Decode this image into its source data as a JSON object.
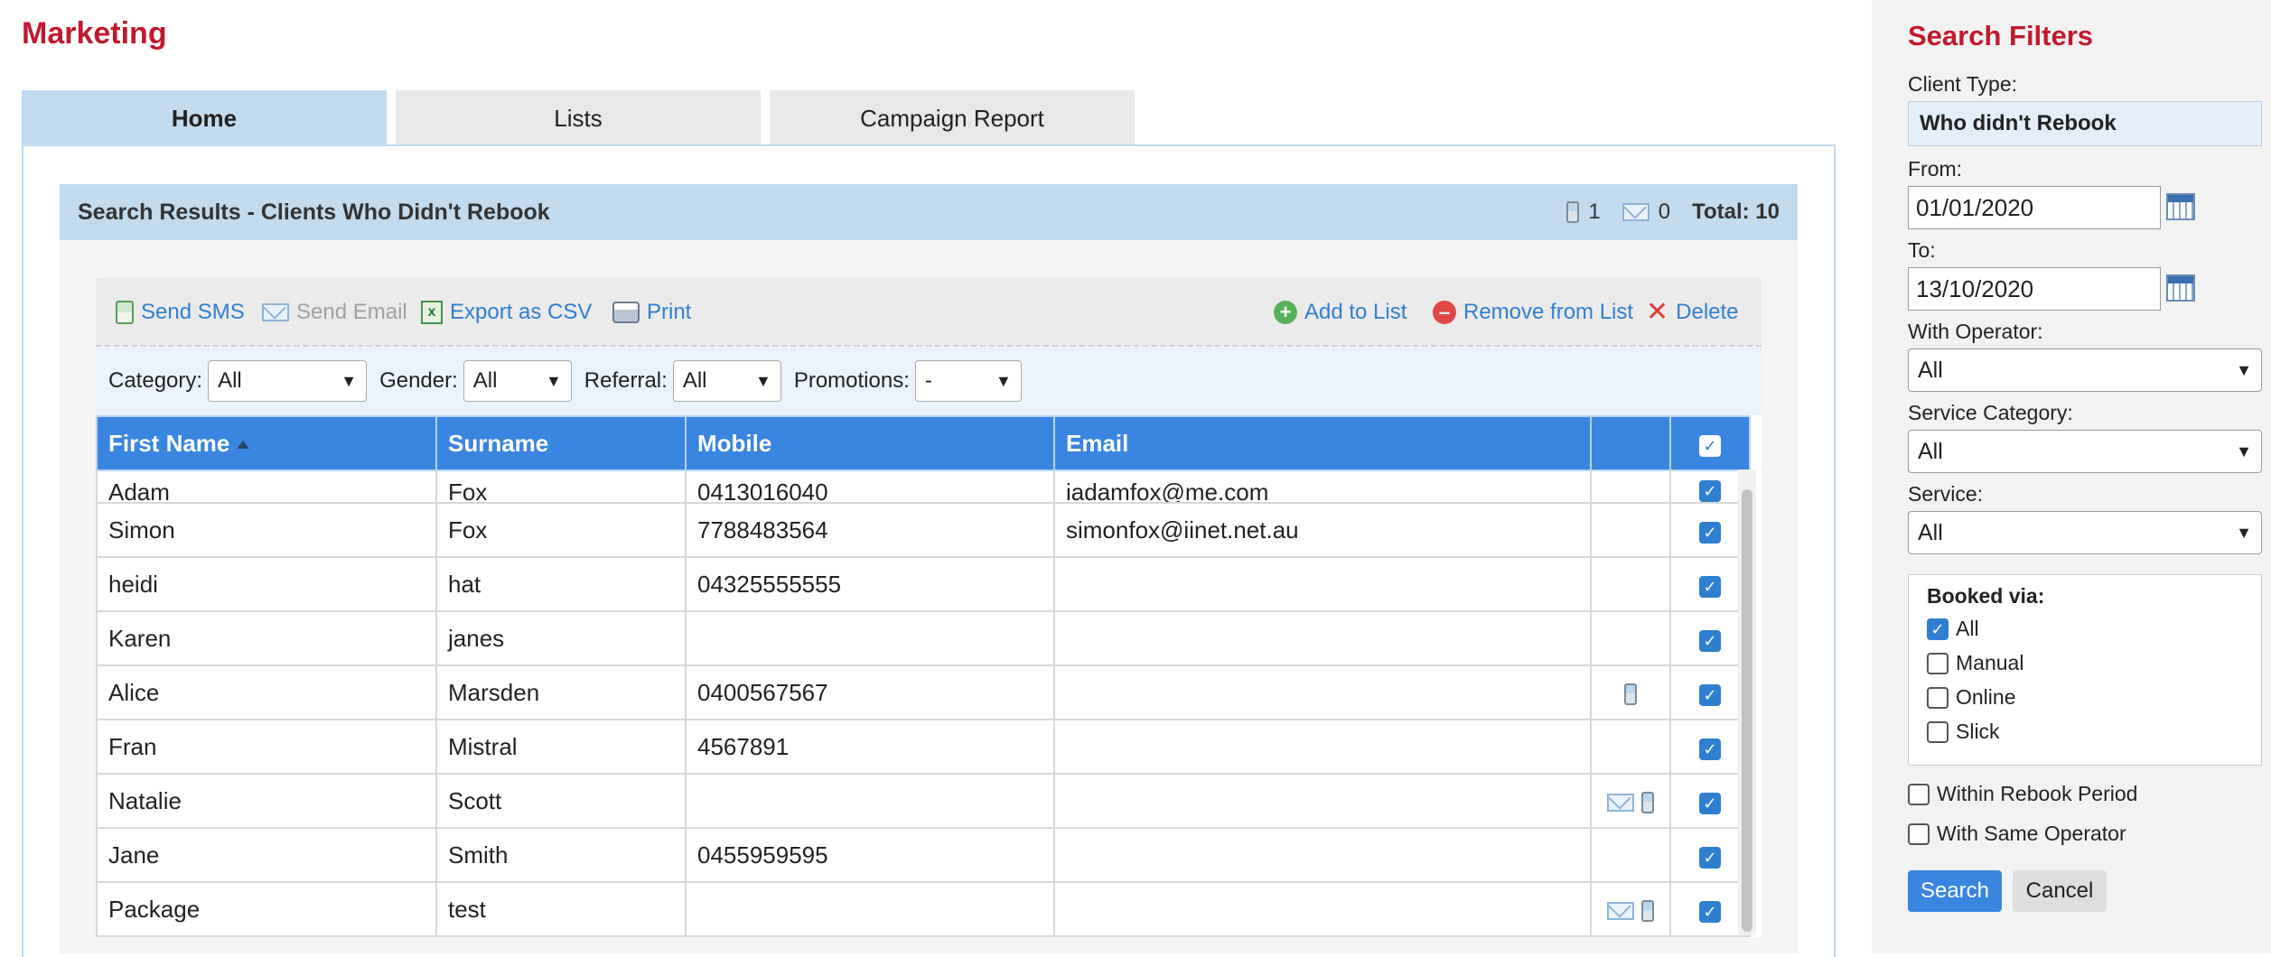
{
  "page": {
    "title": "Marketing"
  },
  "tabs": [
    {
      "label": "Home",
      "active": true
    },
    {
      "label": "Lists",
      "active": false
    },
    {
      "label": "Campaign Report",
      "active": false
    }
  ],
  "results": {
    "title": "Search Results - Clients Who Didn't Rebook",
    "sms_count": "1",
    "email_count": "0",
    "total": "Total: 10"
  },
  "toolbar": {
    "send_sms": "Send SMS",
    "send_email": "Send Email",
    "export_csv": "Export as CSV",
    "print": "Print",
    "add_to_list": "Add to List",
    "remove_from_list": "Remove from List",
    "delete": "Delete"
  },
  "filters": {
    "category_label": "Category:",
    "category_value": "All",
    "gender_label": "Gender:",
    "gender_value": "All",
    "referral_label": "Referral:",
    "referral_value": "All",
    "promotions_label": "Promotions:",
    "promotions_value": "-"
  },
  "table": {
    "columns": [
      "First Name",
      "Surname",
      "Mobile",
      "Email"
    ],
    "rows": [
      {
        "first": "Adam",
        "surname": "Fox",
        "mobile": "0413016040",
        "email": "iadamfox@me.com",
        "icons": "",
        "checked": true
      },
      {
        "first": "Simon",
        "surname": "Fox",
        "mobile": "7788483564",
        "email": "simonfox@iinet.net.au",
        "icons": "",
        "checked": true
      },
      {
        "first": "heidi",
        "surname": "hat",
        "mobile": "04325555555",
        "email": "",
        "icons": "",
        "checked": true
      },
      {
        "first": "Karen",
        "surname": "janes",
        "mobile": "",
        "email": "",
        "icons": "",
        "checked": true
      },
      {
        "first": "Alice",
        "surname": "Marsden",
        "mobile": "0400567567",
        "email": "",
        "icons": "phone",
        "checked": true
      },
      {
        "first": "Fran",
        "surname": "Mistral",
        "mobile": "4567891",
        "email": "",
        "icons": "",
        "checked": true
      },
      {
        "first": "Natalie",
        "surname": "Scott",
        "mobile": "",
        "email": "",
        "icons": "mail-phone",
        "checked": true
      },
      {
        "first": "Jane",
        "surname": "Smith",
        "mobile": "0455959595",
        "email": "",
        "icons": "",
        "checked": true
      },
      {
        "first": "Package",
        "surname": "test",
        "mobile": "",
        "email": "",
        "icons": "mail-phone",
        "checked": true
      }
    ]
  },
  "sidebar": {
    "title": "Search Filters",
    "client_type_label": "Client Type:",
    "client_type_value": "Who didn't Rebook",
    "from_label": "From:",
    "from_value": "01/01/2020",
    "to_label": "To:",
    "to_value": "13/10/2020",
    "operator_label": "With Operator:",
    "operator_value": "All",
    "service_category_label": "Service Category:",
    "service_category_value": "All",
    "service_label": "Service:",
    "service_value": "All",
    "booked_via_title": "Booked via:",
    "booked_via": [
      {
        "label": "All",
        "checked": true
      },
      {
        "label": "Manual",
        "checked": false
      },
      {
        "label": "Online",
        "checked": false
      },
      {
        "label": "Slick",
        "checked": false
      }
    ],
    "within_rebook_label": "Within Rebook Period",
    "same_operator_label": "With Same Operator",
    "search_button": "Search",
    "cancel_button": "Cancel"
  },
  "colors": {
    "brand_red": "#c0192e",
    "accent_blue": "#3a85e0",
    "header_light_blue": "#c2dbee",
    "link_blue": "#2f7fd1"
  }
}
